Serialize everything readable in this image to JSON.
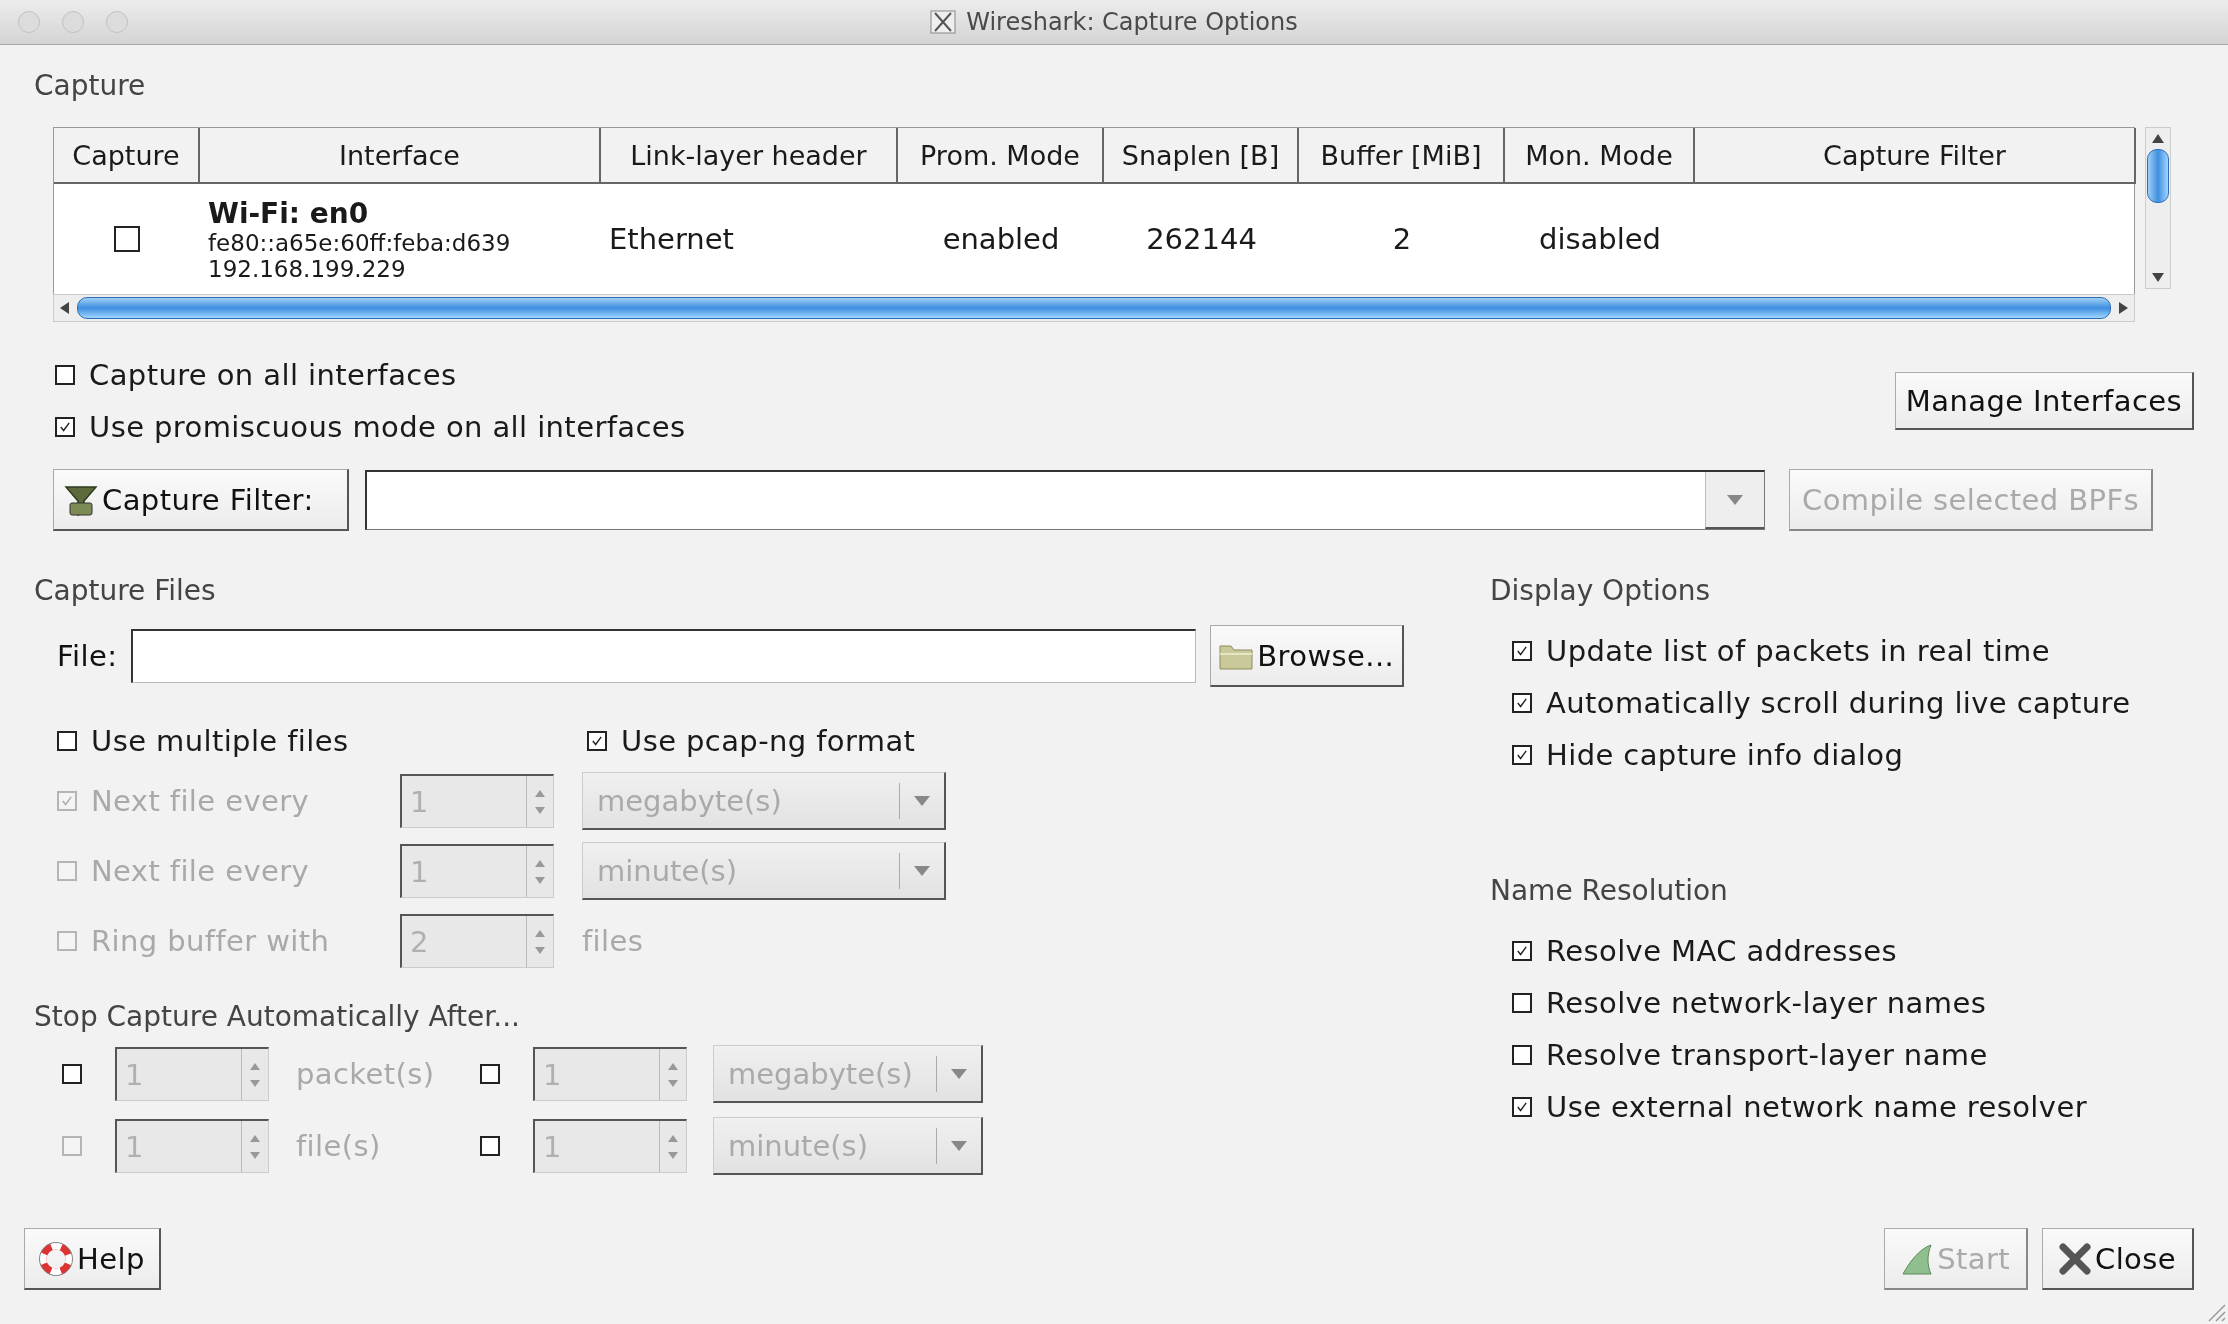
{
  "window": {
    "title": "Wireshark: Capture Options"
  },
  "capture": {
    "heading": "Capture",
    "columns": [
      "Capture",
      "Interface",
      "Link-layer header",
      "Prom. Mode",
      "Snaplen [B]",
      "Buffer [MiB]",
      "Mon. Mode",
      "Capture Filter"
    ],
    "interfaces": [
      {
        "checked": false,
        "name": "Wi-Fi: en0",
        "addresses": [
          "fe80::a65e:60ff:feba:d639",
          "192.168.199.229"
        ],
        "link_layer": "Ethernet",
        "prom_mode": "enabled",
        "snaplen": "262144",
        "buffer": "2",
        "mon_mode": "disabled"
      }
    ],
    "options": [
      {
        "label": "Capture on all interfaces",
        "checked": false
      },
      {
        "label": "Use promiscuous mode on all interfaces",
        "checked": true
      }
    ],
    "manage_button": "Manage Interfaces",
    "filter": {
      "button": "Capture Filter:",
      "compile_button": {
        "label": "Compile selected BPFs",
        "disabled": true
      }
    }
  },
  "capture_files": {
    "heading": "Capture Files",
    "file_label": "File:",
    "browse_button": "Browse...",
    "multiple_files": {
      "label": "Use multiple files",
      "checked": false
    },
    "pcapng": {
      "label": "Use pcap-ng format",
      "checked": true
    },
    "rotation": [
      {
        "label": "Next file every",
        "checked": true,
        "disabled": true,
        "value": "1",
        "kind": "dropdown",
        "unit": "megabyte(s)"
      },
      {
        "label": "Next file every",
        "checked": false,
        "disabled": true,
        "value": "1",
        "kind": "dropdown",
        "unit": "minute(s)"
      },
      {
        "label": "Ring buffer with",
        "checked": false,
        "disabled": true,
        "value": "2",
        "kind": "text",
        "unit": "files"
      }
    ]
  },
  "stop_capture": {
    "heading": "Stop Capture Automatically After...",
    "rows": [
      {
        "conditions": [
          {
            "checked": false,
            "disabled": false,
            "value": "1",
            "kind": "text",
            "unit": "packet(s)"
          },
          {
            "checked": false,
            "disabled": false,
            "value": "1",
            "kind": "dropdown",
            "unit": "megabyte(s)"
          }
        ]
      },
      {
        "conditions": [
          {
            "checked": false,
            "disabled": true,
            "value": "1",
            "kind": "text",
            "unit": "file(s)"
          },
          {
            "checked": false,
            "disabled": false,
            "value": "1",
            "kind": "dropdown",
            "unit": "minute(s)"
          }
        ]
      }
    ]
  },
  "display_options": {
    "heading": "Display Options",
    "items": [
      {
        "label": "Update list of packets in real time",
        "checked": true
      },
      {
        "label": "Automatically scroll during live capture",
        "checked": true
      },
      {
        "label": "Hide capture info dialog",
        "checked": true
      }
    ]
  },
  "name_resolution": {
    "heading": "Name Resolution",
    "items": [
      {
        "label": "Resolve MAC addresses",
        "checked": true
      },
      {
        "label": "Resolve network-layer names",
        "checked": false
      },
      {
        "label": "Resolve transport-layer name",
        "checked": false
      },
      {
        "label": "Use external network name resolver",
        "checked": true
      }
    ]
  },
  "buttons": [
    {
      "kind": "help",
      "label": "Help",
      "disabled": false
    },
    {
      "kind": "start",
      "label": "Start",
      "disabled": true
    },
    {
      "kind": "close",
      "label": "Close",
      "disabled": false
    }
  ]
}
